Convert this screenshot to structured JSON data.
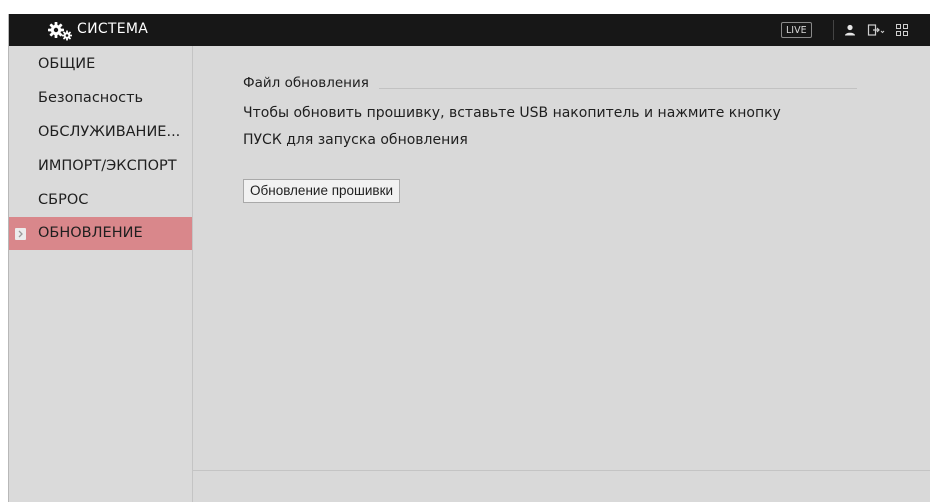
{
  "header": {
    "title": "СИСТЕМА",
    "title_icon": "gear-icon",
    "live_label": "LIVE",
    "icons": [
      "user-icon",
      "logout-icon",
      "grid-menu-icon"
    ]
  },
  "sidebar": {
    "items": [
      {
        "label": "ОБЩИЕ",
        "active": false
      },
      {
        "label": "Безопасность",
        "active": false
      },
      {
        "label": "ОБСЛУЖИВАНИЕ...",
        "active": false
      },
      {
        "label": "ИМПОРТ/ЭКСПОРТ",
        "active": false
      },
      {
        "label": "СБРОС",
        "active": false
      },
      {
        "label": "ОБНОВЛЕНИЕ",
        "active": true
      }
    ],
    "active_color": "#d9878b"
  },
  "main": {
    "section_title": "Файл обновления",
    "description_line1": "Чтобы обновить прошивку, вставьте USB накопитель и нажмите кнопку",
    "description_line2": "ПУСК для запуска обновления",
    "update_button_label": "Обновление прошивки"
  },
  "colors": {
    "topbar": "#171717",
    "background": "#d9d9d9",
    "active_item": "#d9878b"
  }
}
